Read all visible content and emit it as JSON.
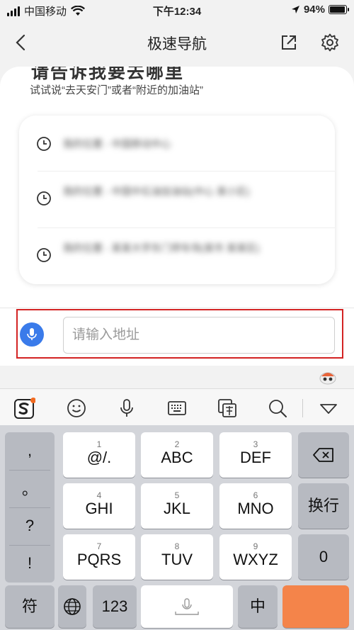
{
  "status_bar": {
    "carrier": "中国移动",
    "time": "下午12:34",
    "battery_percent": "94%",
    "battery_level": 0.94
  },
  "nav": {
    "title": "极速导航"
  },
  "main": {
    "headline": "请告诉我要去哪里",
    "hint": "试试说“去天安门”或者“附近的加油站”",
    "history": [
      {
        "text": "我的位置 - 中国移动中心"
      },
      {
        "text": "我的位置 - 中国中石油加油站(中心 某小区)"
      },
      {
        "text": "我的位置 - 某某大学东门停车场(某市 某某区)"
      }
    ]
  },
  "input": {
    "placeholder": "请输入地址"
  },
  "keyboard": {
    "side_keys": [
      ",",
      "。",
      "?",
      "!"
    ],
    "rows": [
      [
        {
          "num": "1",
          "label": "@/."
        },
        {
          "num": "2",
          "label": "ABC"
        },
        {
          "num": "3",
          "label": "DEF"
        }
      ],
      [
        {
          "num": "4",
          "label": "GHI"
        },
        {
          "num": "5",
          "label": "JKL"
        },
        {
          "num": "6",
          "label": "MNO"
        }
      ],
      [
        {
          "num": "7",
          "label": "PQRS"
        },
        {
          "num": "8",
          "label": "TUV"
        },
        {
          "num": "9",
          "label": "WXYZ"
        }
      ]
    ],
    "newline_label": "换行",
    "zero_label": "0",
    "symbol_label": "符",
    "num_label": "123",
    "chinese_label": "中"
  },
  "colors": {
    "mic_blue": "#3a7bea",
    "highlight_red": "#d32323",
    "key_white": "#ffffff",
    "key_gray": "#b7bac1",
    "keyboard_bg": "#d3d5da"
  }
}
